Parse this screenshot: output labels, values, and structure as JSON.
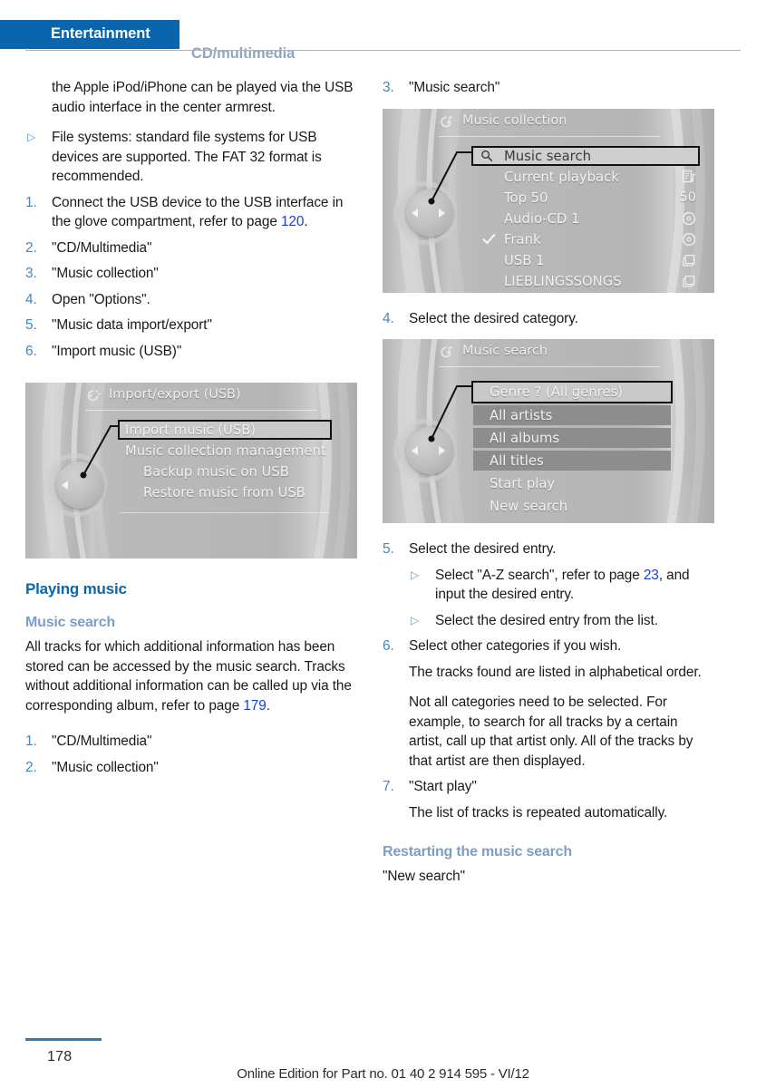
{
  "header": {
    "active_tab": "Entertainment",
    "inactive_tab": "CD/multimedia",
    "accent_color": "#0a65ad"
  },
  "left_column": {
    "intro_paragraph": "the Apple iPod/iPhone can be played via the USB audio interface in the center armrest.",
    "bullet_filesystems": {
      "marker": "▷",
      "text": "File systems: standard file systems for USB devices are supported. The FAT 32 format is recommended."
    },
    "steps": [
      {
        "marker": "1.",
        "text_before": "Connect the USB device to the USB interface in the glove compartment, refer to page ",
        "link": "120",
        "text_after": "."
      },
      {
        "marker": "2.",
        "text": "\"CD/Multimedia\""
      },
      {
        "marker": "3.",
        "text": "\"Music collection\""
      },
      {
        "marker": "4.",
        "text": "Open \"Options\"."
      },
      {
        "marker": "5.",
        "text": "\"Music data import/export\""
      },
      {
        "marker": "6.",
        "text": "\"Import music (USB)\""
      }
    ],
    "screenshot": {
      "title": "Import/export (USB)",
      "title_icon": "usb-import-export-icon",
      "rows": [
        {
          "label": "Import music (USB)",
          "state": "selected"
        },
        {
          "label": "Music collection management",
          "state": "normal"
        },
        {
          "label": "Backup music on USB",
          "state": "normal"
        },
        {
          "label": "Restore music from USB",
          "state": "normal"
        }
      ]
    },
    "heading_playing_music": "Playing music",
    "heading_music_search": "Music search",
    "music_search_paragraph_before": "All tracks for which additional information has been stored can be accessed by the music search. Tracks without additional information can be called up via the corresponding album, refer to page ",
    "music_search_link": "179",
    "music_search_paragraph_after": ".",
    "search_steps": [
      {
        "marker": "1.",
        "text": "\"CD/Multimedia\""
      },
      {
        "marker": "2.",
        "text": "\"Music collection\""
      }
    ]
  },
  "right_column": {
    "step3": {
      "marker": "3.",
      "text": "\"Music search\""
    },
    "screenshot_collection": {
      "title": "Music collection",
      "title_icon": "music-collection-icon",
      "rows": [
        {
          "label": "Music search",
          "left_icon": "magnifier-icon",
          "right_icon": "",
          "state": "selected"
        },
        {
          "label": "Current playback",
          "left_icon": "",
          "right_icon": "now-playing-icon",
          "state": "normal"
        },
        {
          "label": "Top 50",
          "left_icon": "",
          "right_icon": "50",
          "state": "normal"
        },
        {
          "label": "Audio-CD 1",
          "left_icon": "",
          "right_icon": "disc-icon",
          "state": "normal"
        },
        {
          "label": "Frank",
          "left_icon": "check-icon",
          "right_icon": "disc-icon",
          "state": "normal"
        },
        {
          "label": "USB 1",
          "left_icon": "",
          "right_icon": "folder-icon",
          "state": "normal"
        },
        {
          "label": "LIEBLINGSSONGS",
          "left_icon": "",
          "right_icon": "folder-icon",
          "state": "normal"
        }
      ]
    },
    "step4": {
      "marker": "4.",
      "text": "Select the desired category."
    },
    "screenshot_search": {
      "title": "Music search",
      "title_icon": "music-search-icon",
      "rows": [
        {
          "label": "Genre ? (All genres)",
          "state": "selected-band"
        },
        {
          "label": "All artists",
          "state": "band"
        },
        {
          "label": "All albums",
          "state": "band"
        },
        {
          "label": "All titles",
          "state": "band"
        },
        {
          "label": "Start play",
          "state": "normal"
        },
        {
          "label": "New search",
          "state": "normal"
        }
      ]
    },
    "step5": {
      "marker": "5.",
      "text": "Select the desired entry."
    },
    "step5_sub1": {
      "marker": "▷",
      "text_before": "Select \"A-Z search\", refer to page ",
      "link": "23",
      "text_after": ", and input the desired entry."
    },
    "step5_sub2": {
      "marker": "▷",
      "text": "Select the desired entry from the list."
    },
    "step6": {
      "marker": "6.",
      "text": "Select other categories if you wish."
    },
    "step6_note1": "The tracks found are listed in alphabetical order.",
    "step6_note2": "Not all categories need to be selected. For example, to search for all tracks by a certain artist, call up that artist only. All of the tracks by that artist are then displayed.",
    "step7": {
      "marker": "7.",
      "text": "\"Start play\""
    },
    "step7_note": "The list of tracks is repeated automatically.",
    "heading_restarting": "Restarting the music search",
    "restarting_text": "\"New search\""
  },
  "footer": {
    "page_number": "178",
    "note": "Online Edition for Part no. 01 40 2 914 595 - VI/12"
  }
}
